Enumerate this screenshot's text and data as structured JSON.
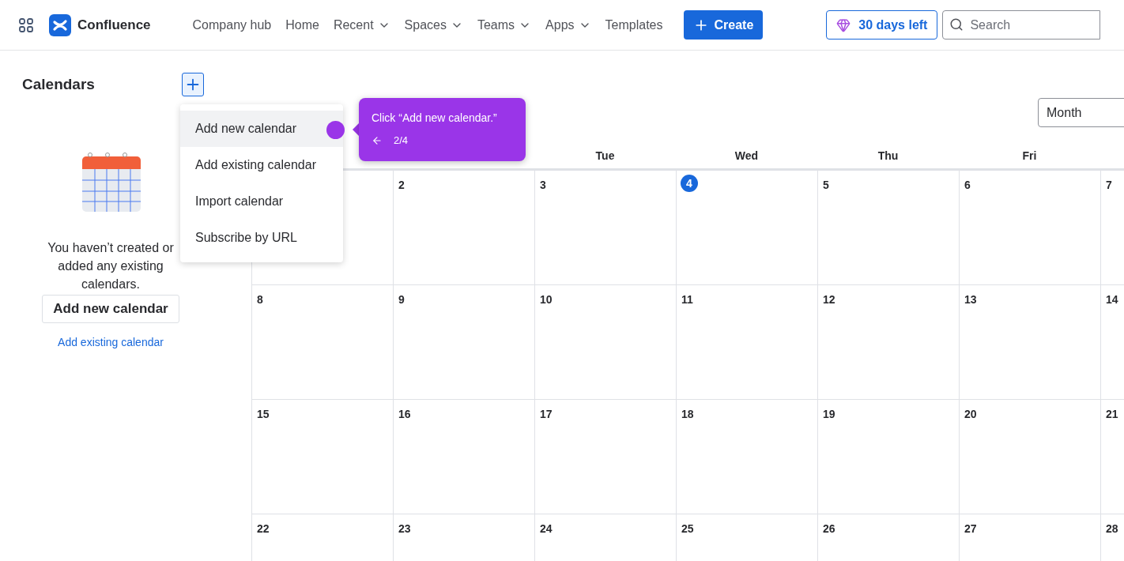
{
  "header": {
    "product": "Confluence",
    "nav": [
      {
        "label": "Company hub",
        "dropdown": false
      },
      {
        "label": "Home",
        "dropdown": false
      },
      {
        "label": "Recent",
        "dropdown": true
      },
      {
        "label": "Spaces",
        "dropdown": true
      },
      {
        "label": "Teams",
        "dropdown": true
      },
      {
        "label": "Apps",
        "dropdown": true
      },
      {
        "label": "Templates",
        "dropdown": false
      }
    ],
    "create": "Create",
    "trial": "30 days left",
    "search": {
      "placeholder": "Search"
    }
  },
  "sidebar": {
    "title": "Calendars",
    "empty_text": "You haven’t created or added any existing calendars.",
    "primary_button": "Add new calendar",
    "link": "Add existing calendar"
  },
  "menu": {
    "items": [
      {
        "label": "Add new calendar",
        "selected": true
      },
      {
        "label": "Add existing calendar",
        "selected": false
      },
      {
        "label": "Import calendar",
        "selected": false
      },
      {
        "label": "Subscribe by URL",
        "selected": false
      }
    ]
  },
  "guide": {
    "text": "Click “Add new calendar.”",
    "step": "2/4"
  },
  "view_select": {
    "value": "Month"
  },
  "calendar": {
    "headers": [
      "Tue",
      "Wed",
      "Thu",
      "Fri"
    ],
    "weeks": [
      [
        {
          "day": "2",
          "today": false
        },
        {
          "day": "3",
          "today": false
        },
        {
          "day": "4",
          "today": true
        },
        {
          "day": "5",
          "today": false
        },
        {
          "day": "6",
          "today": false
        },
        {
          "day": "7",
          "today": false
        }
      ],
      [
        {
          "day": "8",
          "today": false
        },
        {
          "day": "9",
          "today": false
        },
        {
          "day": "10",
          "today": false
        },
        {
          "day": "11",
          "today": false
        },
        {
          "day": "12",
          "today": false
        },
        {
          "day": "13",
          "today": false
        },
        {
          "day": "14",
          "today": false
        }
      ],
      [
        {
          "day": "15",
          "today": false
        },
        {
          "day": "16",
          "today": false
        },
        {
          "day": "17",
          "today": false
        },
        {
          "day": "18",
          "today": false
        },
        {
          "day": "19",
          "today": false
        },
        {
          "day": "20",
          "today": false
        },
        {
          "day": "21",
          "today": false
        }
      ],
      [
        {
          "day": "22",
          "today": false
        },
        {
          "day": "23",
          "today": false
        },
        {
          "day": "24",
          "today": false
        },
        {
          "day": "25",
          "today": false
        },
        {
          "day": "26",
          "today": false
        },
        {
          "day": "27",
          "today": false
        },
        {
          "day": "28",
          "today": false
        }
      ]
    ]
  }
}
